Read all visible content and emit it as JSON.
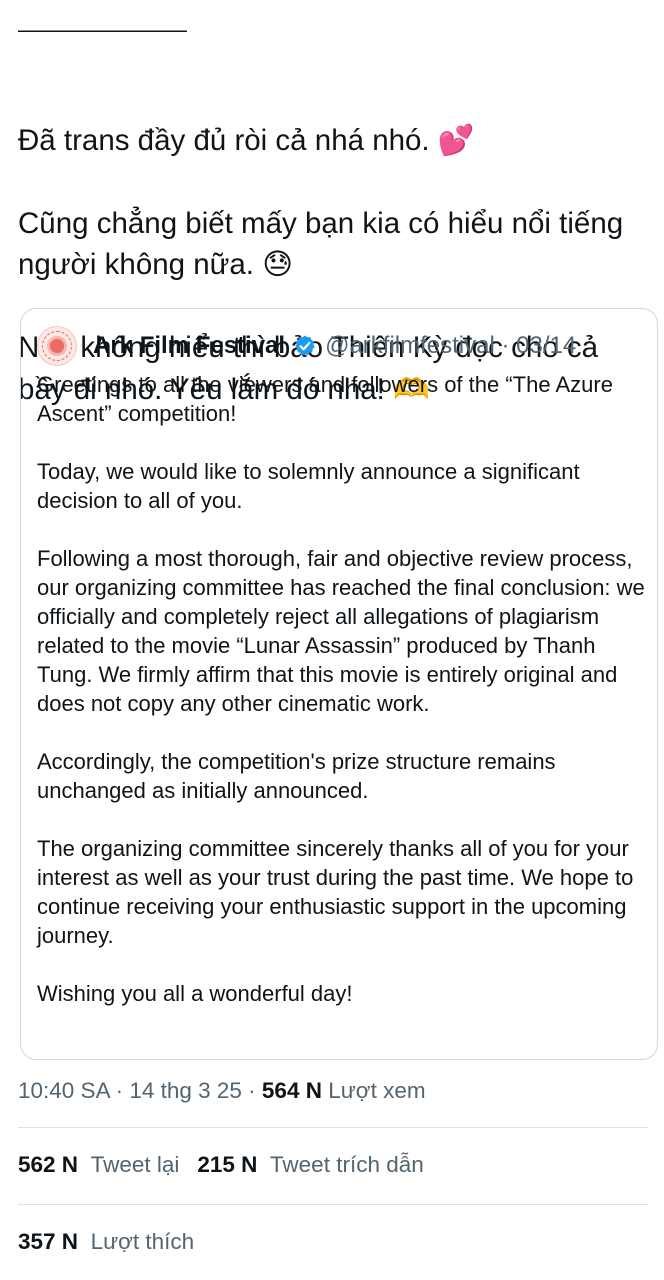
{
  "divider": "————————",
  "tweet": {
    "lines": [
      "Đã trans đầy đủ ròi cả nhá nhó. ",
      "Cũng chẳng biết mấy bạn kia có hiểu nổi tiếng người không nữa. ",
      "Nếu không hiểu thì bảo Thiên Kỳ đọc cho cả bầy đi nhó. Yêu lắm đó nha! "
    ],
    "emojis": [
      "💕",
      "😓",
      "🫶"
    ]
  },
  "quote": {
    "name": "Ark Film Festival",
    "handle": "@arkfilmfestival · 03/14",
    "paragraphs": [
      "Greetings to all the viewers and followers of the “The Azure Ascent” competition!",
      "Today, we would like to solemnly announce a significant decision to all of you.",
      "Following a most thorough, fair and objective review process, our organizing committee has reached the final conclusion: we officially and completely reject all allegations of plagiarism related to the movie “Lunar Assassin” produced by Thanh Tung. We firmly affirm that this movie is entirely original and does not copy any other cinematic work.",
      "Accordingly, the competition's prize structure remains unchanged as initially announced.",
      "The organizing committee sincerely thanks all of you for your interest as well as your trust during the past time. We hope to continue receiving your enthusiastic support in the upcoming journey.",
      "Wishing you all a wonderful day!"
    ]
  },
  "meta": {
    "time": "10:40 SA · 14 thg 3 25 · ",
    "views_count": "564 N",
    "views_label": "Lượt xem"
  },
  "stats": {
    "retweets_count": "562 N",
    "retweets_label": "Tweet lại",
    "quotes_count": "215 N",
    "quotes_label": "Tweet trích dẫn",
    "likes_count": "357 N",
    "likes_label": "Lượt thích"
  },
  "colors": {
    "text": "#0f1419",
    "secondary": "#536471",
    "border": "#cfd9de",
    "verified": "#1d9bf0"
  }
}
